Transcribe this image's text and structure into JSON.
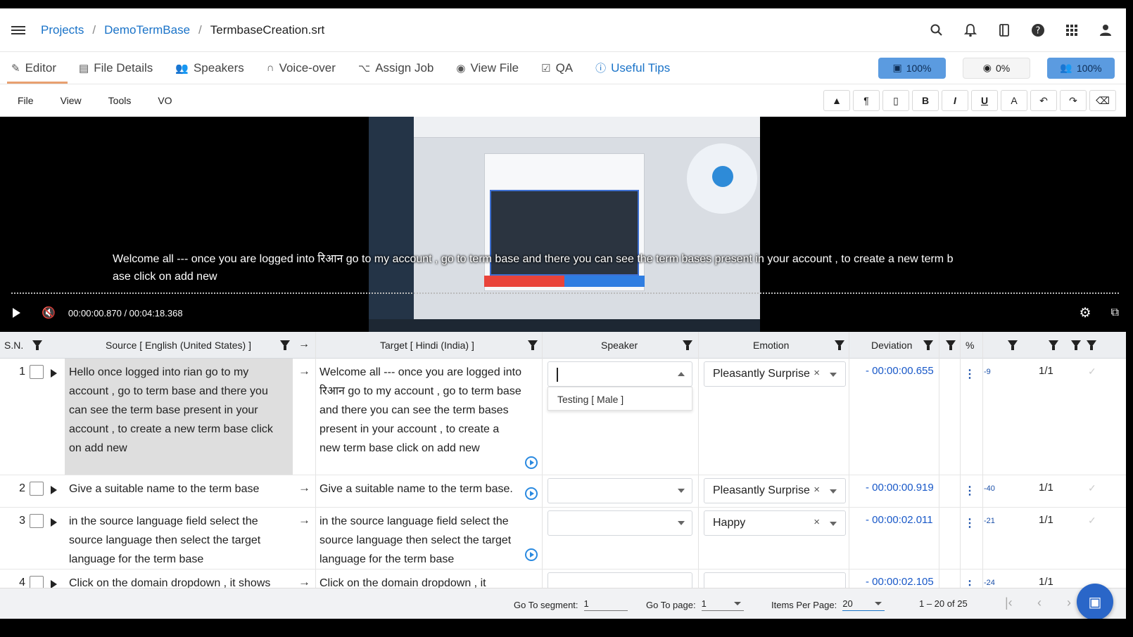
{
  "breadcrumb": {
    "root": "Projects",
    "project": "DemoTermBase",
    "file": "TermbaseCreation.srt"
  },
  "top_icons": [
    "search-icon",
    "bell-icon",
    "bookmark-icon",
    "help-icon",
    "apps-grid-icon",
    "account-icon"
  ],
  "tabs": [
    {
      "label": "Editor",
      "icon": "edit-icon",
      "active": true
    },
    {
      "label": "File Details",
      "icon": "file-icon"
    },
    {
      "label": "Speakers",
      "icon": "speakers-icon"
    },
    {
      "label": "Voice-over",
      "icon": "headphones-icon"
    },
    {
      "label": "Assign Job",
      "icon": "assign-icon"
    },
    {
      "label": "View File",
      "icon": "eye-icon"
    },
    {
      "label": "QA",
      "icon": "qa-icon"
    },
    {
      "label": "Useful Tips",
      "icon": "info-icon"
    }
  ],
  "progress_pills": {
    "translation": "100%",
    "review": "0%",
    "speakers": "100%"
  },
  "menus": [
    "File",
    "View",
    "Tools",
    "VO"
  ],
  "format_buttons": [
    "¶",
    "",
    "B",
    "I",
    "U",
    "A",
    "↶",
    "↷"
  ],
  "video": {
    "subtitle_line1": "Welcome all --- once you are logged into रिआन go to my account , go to term base and there you can see the term bases present in your account , to create a new term b",
    "subtitle_line2": "ase click on add new",
    "time": "00:00:00.870 / 00:04:18.368"
  },
  "columns": {
    "sn": "S.N.",
    "source": "Source [ English (United States) ]",
    "target": "Target [ Hindi (India) ]",
    "speaker": "Speaker",
    "emotion": "Emotion",
    "deviation": "Deviation",
    "percent": "%"
  },
  "rows": [
    {
      "sn": "1",
      "source": "Hello once logged into rian go to my account , go to term base and there you can see the term base present in your account , to create a new term base click on add new",
      "target": "Welcome all --- once you are logged into रिआन go to my account , go to term base and there you can see the term bases present in your account , to create a new term base click on add new",
      "speaker": "",
      "speaker_option": "Testing [ Male ]",
      "emotion": "Pleasantly Surprise",
      "deviation": "- 00:00:00.655",
      "percent": "-9",
      "fraction": "1/1"
    },
    {
      "sn": "2",
      "source": "Give a suitable name to the term base",
      "target": "Give a suitable name to the term base.",
      "speaker": "",
      "emotion": "Pleasantly Surprise",
      "deviation": "- 00:00:00.919",
      "percent": "-40",
      "fraction": "1/1"
    },
    {
      "sn": "3",
      "source": "in the source language field select the source language then select the target language for the term base",
      "target": "in the source language field select the source language then select the target language for the term base",
      "speaker": "",
      "emotion": "Happy",
      "deviation": "- 00:00:02.011",
      "percent": "-21",
      "fraction": "1/1"
    },
    {
      "sn": "4",
      "source": "Click on the domain dropdown , it shows",
      "target": "Click on the domain dropdown , it",
      "speaker": "",
      "emotion": "",
      "deviation": "- 00:00:02.105",
      "percent": "-24",
      "fraction": "1/1"
    }
  ],
  "footer": {
    "goto_segment_label": "Go To segment:",
    "goto_segment_value": "1",
    "goto_page_label": "Go To page:",
    "goto_page_value": "1",
    "items_per_page_label": "Items Per Page:",
    "items_per_page_value": "20",
    "range": "1 – 20 of 25"
  },
  "colors": {
    "accent_blue": "#1a73c8",
    "pill_blue": "#5b9be0",
    "deviation_blue": "#1858c8",
    "selected_row": "#dedede"
  }
}
